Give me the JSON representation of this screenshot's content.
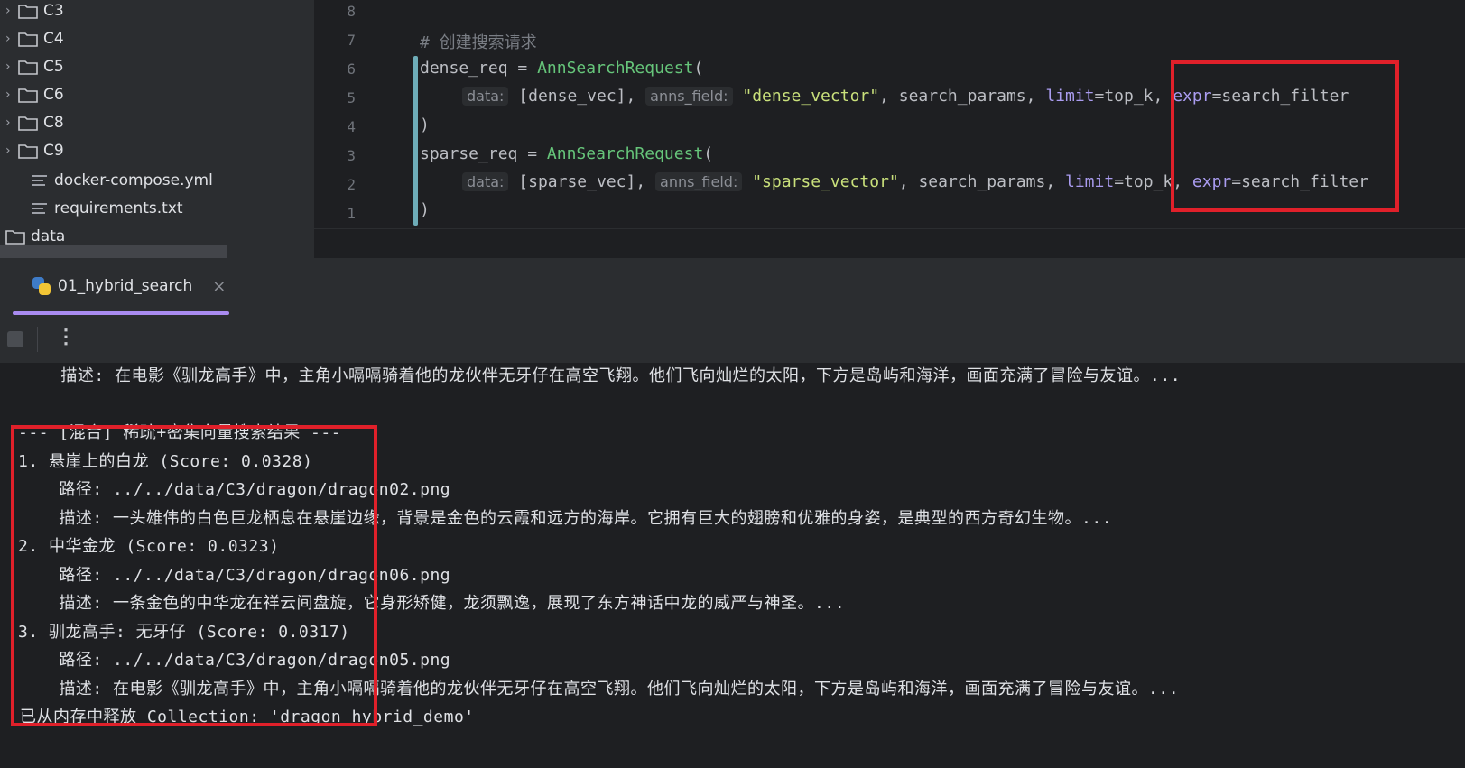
{
  "sidebar": {
    "folders": [
      "C3",
      "C4",
      "C5",
      "C6",
      "C8",
      "C9"
    ],
    "files": [
      "docker-compose.yml",
      "requirements.txt"
    ],
    "root_folder": "data"
  },
  "editor": {
    "line_numbers": [
      "8",
      "7",
      "6",
      "5",
      "4",
      "3",
      "2",
      "1"
    ],
    "comment": "# 创建搜索请求",
    "dense": {
      "var": "dense_req",
      "eq": " = ",
      "cls": "AnnSearchRequest",
      "open": "(",
      "hint_data": "data:",
      "arg_data": "[dense_vec],",
      "hint_field": "anns_field:",
      "arg_field": "\"dense_vector\"",
      "rest": ", search_params, ",
      "kw_limit": "limit",
      "limit_val": "=top_k, ",
      "kw_expr": "expr",
      "expr_val": "=search_filter",
      "close": ")"
    },
    "sparse": {
      "var": "sparse_req",
      "eq": " = ",
      "cls": "AnnSearchRequest",
      "open": "(",
      "hint_data": "data:",
      "arg_data": "[sparse_vec],",
      "hint_field": "anns_field:",
      "arg_field": "\"sparse_vector\"",
      "rest": ", search_params, ",
      "kw_limit": "limit",
      "limit_val": "=top_k, ",
      "kw_expr": "expr",
      "expr_val": "=search_filter",
      "close": ")"
    }
  },
  "run_tab": {
    "label": "01_hybrid_search",
    "close": "×"
  },
  "console": {
    "lines": [
      "    描述: 在电影《驯龙高手》中，主角小嗝嗝骑着他的龙伙伴无牙仔在高空飞翔。他们飞向灿烂的太阳，下方是岛屿和海洋，画面充满了冒险与友谊。...",
      "",
      "--- [混合] 稀疏+密集向量搜索结果 ---",
      "1. 悬崖上的白龙 (Score: 0.0328)",
      "    路径: ../../data/C3/dragon/dragon02.png",
      "    描述: 一头雄伟的白色巨龙栖息在悬崖边缘，背景是金色的云霞和远方的海岸。它拥有巨大的翅膀和优雅的身姿，是典型的西方奇幻生物。...",
      "2. 中华金龙 (Score: 0.0323)",
      "    路径: ../../data/C3/dragon/dragon06.png",
      "    描述: 一条金色的中华龙在祥云间盘旋，它身形矫健，龙须飘逸，展现了东方神话中龙的威严与神圣。...",
      "3. 驯龙高手: 无牙仔 (Score: 0.0317)",
      "    路径: ../../data/C3/dragon/dragon05.png",
      "    描述: 在电影《驯龙高手》中，主角小嗝嗝骑着他的龙伙伴无牙仔在高空飞翔。他们飞向灿烂的太阳，下方是岛屿和海洋，画面充满了冒险与友谊。...",
      "已从内存中释放 Collection: 'dragon_hybrid_demo'"
    ]
  },
  "colors": {
    "highlight_box": "#e0202a",
    "tab_accent": "#a98bf0"
  }
}
